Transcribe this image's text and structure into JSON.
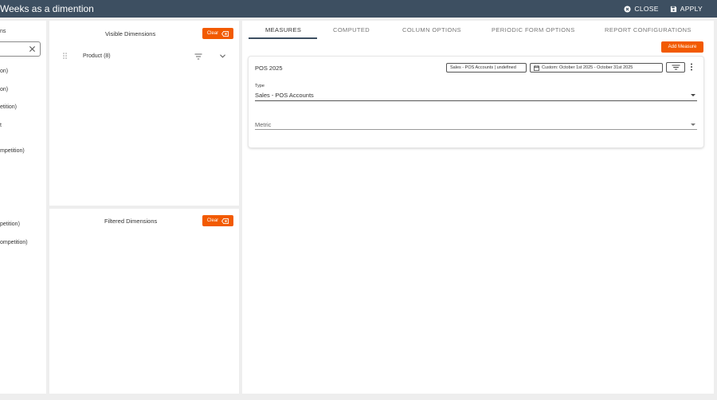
{
  "window": {
    "title": "Weeks as a dimention",
    "close_label": "CLOSE",
    "apply_label": "APPLY",
    "close_icon": "close-circle-icon",
    "apply_icon": "save-icon"
  },
  "left_list": {
    "header": "ns",
    "search_value": "",
    "search_clear_icon": "close-icon",
    "items": [
      "on)",
      "on)",
      "etition)",
      "t",
      "mpetition)",
      "petition)",
      "ompetition)"
    ]
  },
  "visible_dimensions": {
    "title": "Visible Dimensions",
    "clear_label": "Clear",
    "items": [
      {
        "name": "Product (8)",
        "drag_icon": "drag-handle-icon",
        "filter_icon": "filter-icon",
        "expand_icon": "chevron-down-icon"
      }
    ]
  },
  "filtered_dimensions": {
    "title": "Filtered Dimensions",
    "clear_label": "Clear"
  },
  "tabs": [
    {
      "label": "MEASURES",
      "active": true
    },
    {
      "label": "COMPUTED",
      "active": false
    },
    {
      "label": "COLUMN OPTIONS",
      "active": false
    },
    {
      "label": "PERIODIC FORM OPTIONS",
      "active": false
    },
    {
      "label": "REPORT CONFIGURATIONS",
      "active": false
    }
  ],
  "add_measure_label": "Add Measure",
  "measure_card": {
    "title": "POS 2025",
    "accounts_chip": "Sales - POS Accounts | undefined",
    "date_chip": "Custom: October 1st 2025 - October 31st 2025",
    "date_icon": "calendar-icon",
    "filter_icon": "filter-icon",
    "menu_icon": "more-vertical-icon",
    "type_label": "Type",
    "type_value": "Sales - POS Accounts",
    "metric_placeholder": "Metric",
    "metric_value": ""
  },
  "colors": {
    "header_bg": "#3d4f61",
    "accent": "#f25a00",
    "background": "#eeeeee"
  }
}
